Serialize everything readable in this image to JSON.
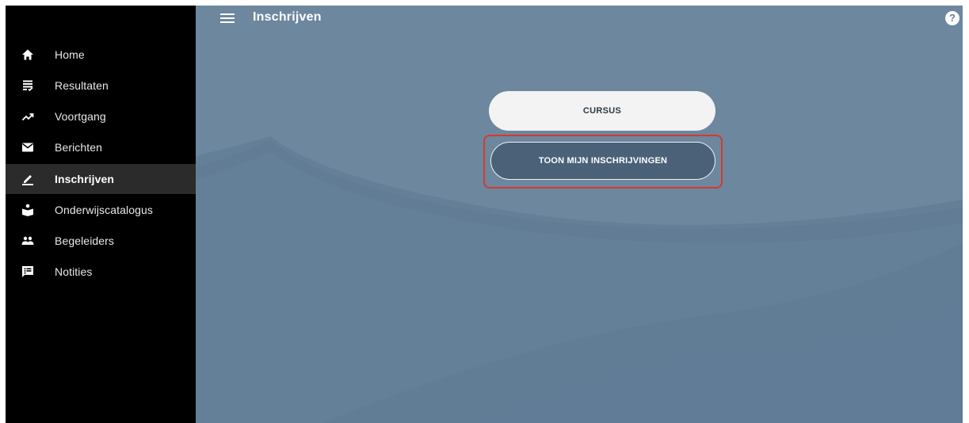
{
  "header": {
    "title": "Inschrijven",
    "help_label": "?"
  },
  "sidebar": {
    "items": [
      {
        "label": "Home",
        "icon": "home-icon"
      },
      {
        "label": "Resultaten",
        "icon": "results-icon"
      },
      {
        "label": "Voortgang",
        "icon": "trending-up-icon"
      },
      {
        "label": "Berichten",
        "icon": "mail-icon"
      },
      {
        "label": "Inschrijven",
        "icon": "edit-icon",
        "active": true
      },
      {
        "label": "Onderwijscatalogus",
        "icon": "catalog-icon"
      },
      {
        "label": "Begeleiders",
        "icon": "people-icon"
      },
      {
        "label": "Notities",
        "icon": "notes-icon"
      }
    ]
  },
  "main": {
    "cursus_button": "CURSUS",
    "toon_button": "TOON MIJN INSCHRIJVINGEN"
  },
  "colors": {
    "sidebar_bg": "#000000",
    "active_item_bg": "#2b2b2b",
    "main_bg": "#647f98",
    "highlight": "#d63a2a"
  }
}
